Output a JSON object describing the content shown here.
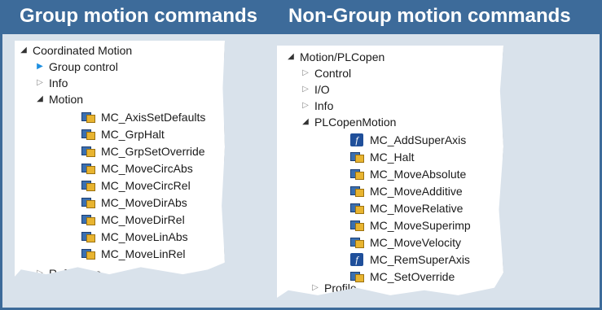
{
  "header": {
    "left_title": "Group motion commands",
    "right_title": "Non-Group motion commands"
  },
  "left_tree": {
    "root": "Coordinated Motion",
    "group_control": "Group control",
    "info": "Info",
    "motion": "Motion",
    "items": [
      "MC_AxisSetDefaults",
      "MC_GrpHalt",
      "MC_GrpSetOverride",
      "MC_MoveCircAbs",
      "MC_MoveCircRel",
      "MC_MoveDirAbs",
      "MC_MoveDirRel",
      "MC_MoveLinAbs",
      "MC_MoveLinRel"
    ],
    "cut_off": "Reference"
  },
  "right_tree": {
    "root": "Motion/PLCopen",
    "control": "Control",
    "io": "I/O",
    "info": "Info",
    "plcopen_motion": "PLCopenMotion",
    "items": [
      {
        "label": "MC_AddSuperAxis",
        "icon": "function-icon"
      },
      {
        "label": "MC_Halt",
        "icon": "function-block-icon"
      },
      {
        "label": "MC_MoveAbsolute",
        "icon": "function-block-icon"
      },
      {
        "label": "MC_MoveAdditive",
        "icon": "function-block-icon"
      },
      {
        "label": "MC_MoveRelative",
        "icon": "function-block-icon"
      },
      {
        "label": "MC_MoveSuperimp",
        "icon": "function-block-icon"
      },
      {
        "label": "MC_MoveVelocity",
        "icon": "function-block-icon"
      },
      {
        "label": "MC_RemSuperAxis",
        "icon": "function-icon"
      },
      {
        "label": "MC_SetOverride",
        "icon": "function-block-icon"
      }
    ],
    "profile": "Profile"
  },
  "colors": {
    "header_bg": "#3d6b9a",
    "frame_bg": "#d9e2eb",
    "fb_blue": "#3a6fb0",
    "fb_yellow": "#e8b430",
    "fn_blue": "#1f4f9a"
  }
}
